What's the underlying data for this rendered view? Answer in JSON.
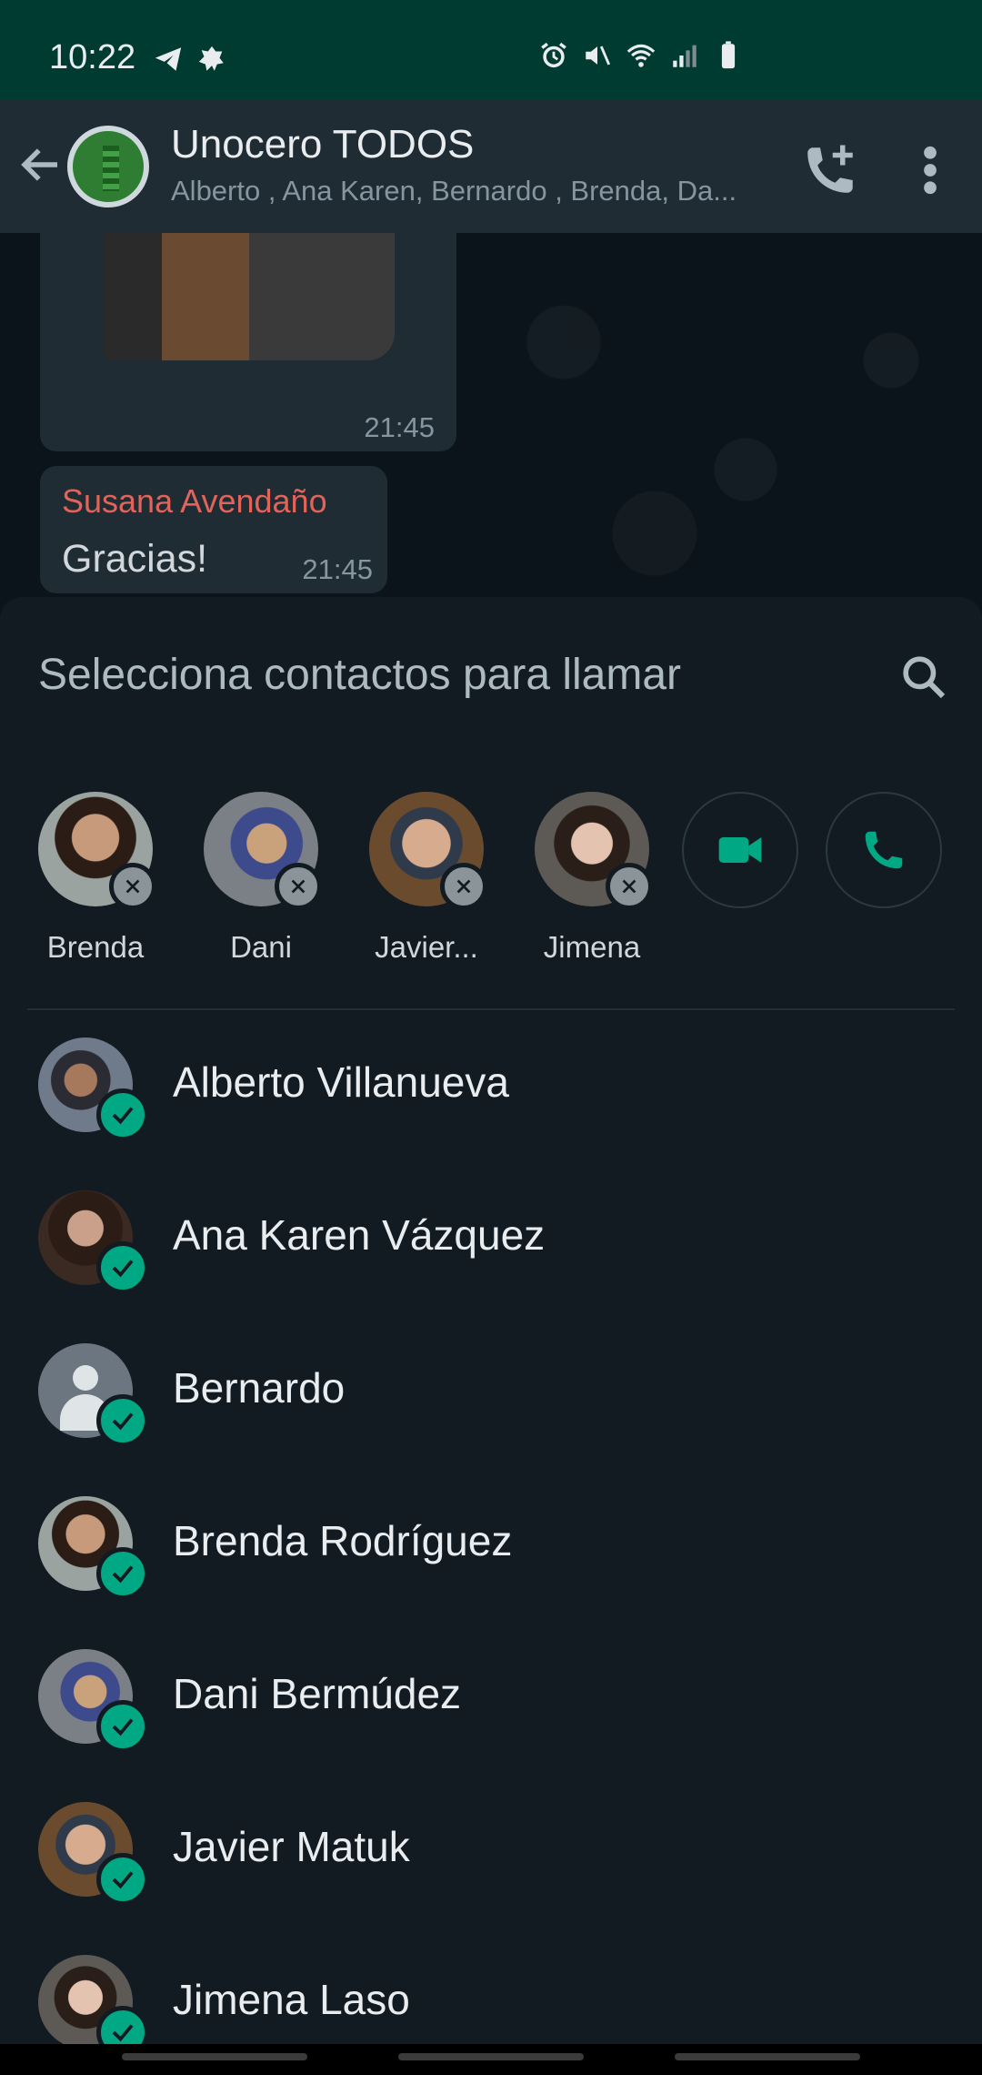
{
  "status_bar": {
    "time": "10:22",
    "left_icons": [
      "telegram-icon",
      "badge-icon"
    ],
    "right_icons": [
      "alarm-icon",
      "mute-icon",
      "wifi-icon",
      "signal-icon",
      "battery-icon"
    ]
  },
  "header": {
    "title": "Unocero TODOS",
    "subtitle": "Alberto , Ana Karen, Bernardo , Brenda, Da..."
  },
  "chat": {
    "media_time": "21:45",
    "message": {
      "sender": "Susana Avendaño",
      "text": "Gracias!",
      "time": "21:45"
    }
  },
  "sheet": {
    "title": "Selecciona contactos para llamar",
    "selected": [
      {
        "name": "Brenda"
      },
      {
        "name": "Dani"
      },
      {
        "name": "Javier..."
      },
      {
        "name": "Jimena"
      }
    ],
    "contacts": [
      {
        "name": "Alberto Villanueva",
        "checked": true
      },
      {
        "name": "Ana Karen Vázquez",
        "checked": true
      },
      {
        "name": "Bernardo",
        "checked": true
      },
      {
        "name": "Brenda Rodríguez",
        "checked": true
      },
      {
        "name": "Dani Bermúdez",
        "checked": true
      },
      {
        "name": "Javier Matuk",
        "checked": true
      },
      {
        "name": "Jimena Laso",
        "checked": true
      }
    ]
  },
  "colors": {
    "accent": "#00a884",
    "status_bar": "#003b31",
    "header": "#1f2c34",
    "sheet": "#121b22",
    "sender_name": "#e1635a"
  }
}
